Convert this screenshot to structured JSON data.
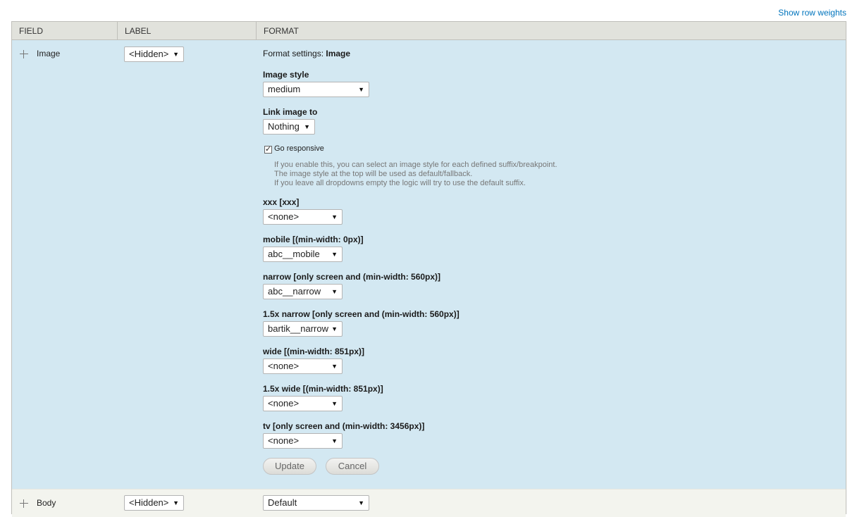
{
  "top_link": "Show row weights",
  "headers": {
    "field": "FIELD",
    "label": "LABEL",
    "format": "FORMAT"
  },
  "image_row": {
    "field": "Image",
    "label_select": "<Hidden>",
    "settings_prefix": "Format settings: ",
    "settings_name": "Image",
    "image_style": {
      "label": "Image style",
      "value": "medium"
    },
    "link_image": {
      "label": "Link image to",
      "value": "Nothing"
    },
    "responsive": {
      "label": "Go responsive",
      "checked": true,
      "help": [
        "If you enable this, you can select an image style for each defined suffix/breakpoint.",
        "The image style at the top will be used as default/fallback.",
        "If you leave all dropdowns empty the logic will try to use the default suffix."
      ]
    },
    "breakpoints": [
      {
        "label": "xxx [xxx]",
        "value": "<none>"
      },
      {
        "label": "mobile [(min-width: 0px)]",
        "value": "abc__mobile"
      },
      {
        "label": "narrow [only screen and (min-width: 560px)]",
        "value": "abc__narrow"
      },
      {
        "label": "1.5x narrow [only screen and (min-width: 560px)]",
        "value": "bartik__narrow"
      },
      {
        "label": "wide [(min-width: 851px)]",
        "value": "<none>"
      },
      {
        "label": "1.5x wide [(min-width: 851px)]",
        "value": "<none>"
      },
      {
        "label": "tv [only screen and (min-width: 3456px)]",
        "value": "<none>"
      }
    ],
    "update_label": "Update",
    "cancel_label": "Cancel"
  },
  "body_row": {
    "field": "Body",
    "label_select": "<Hidden>",
    "format_select": "Default"
  },
  "icons": {
    "drag": "drag-handle-icon",
    "dropdown": "triangle-down-icon",
    "check": "checkmark-icon"
  }
}
